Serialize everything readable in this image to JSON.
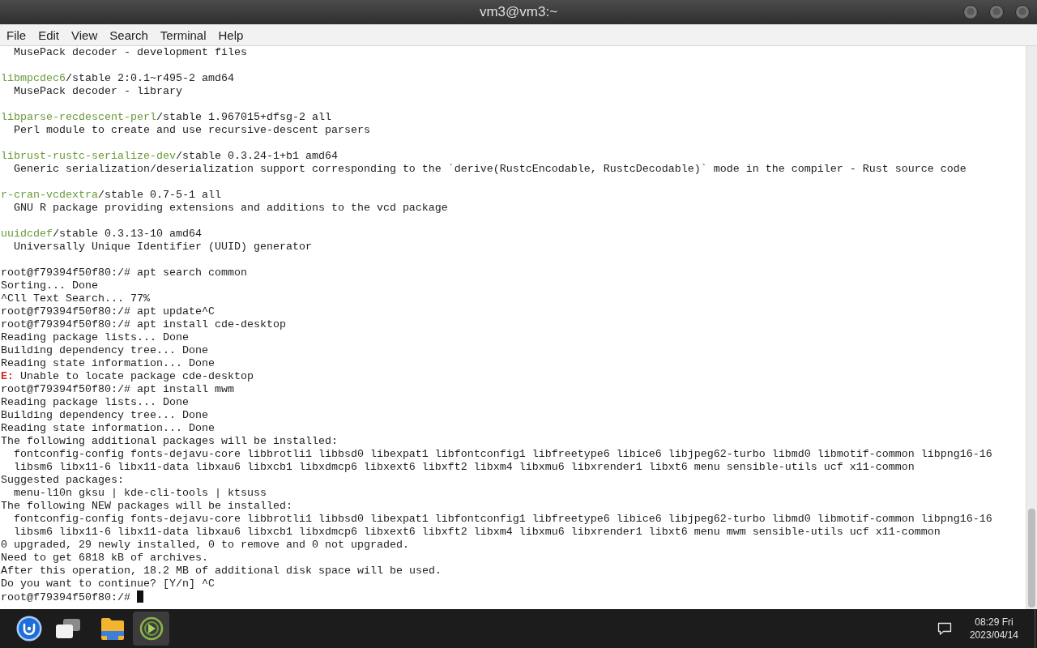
{
  "window": {
    "title": "vm3@vm3:~"
  },
  "menu": [
    "File",
    "Edit",
    "View",
    "Search",
    "Terminal",
    "Help"
  ],
  "terminal": {
    "lines": [
      {
        "kind": "detail",
        "text": "MusePack decoder - development files"
      },
      {
        "kind": "blank"
      },
      {
        "kind": "package",
        "name": "libmpcdec6",
        "text": "/stable 2:0.1~r495-2 amd64"
      },
      {
        "kind": "detail",
        "text": "MusePack decoder - library"
      },
      {
        "kind": "blank"
      },
      {
        "kind": "package",
        "name": "libparse-recdescent-perl",
        "text": "/stable 1.967015+dfsg-2 all"
      },
      {
        "kind": "detail",
        "text": "Perl module to create and use recursive-descent parsers"
      },
      {
        "kind": "blank"
      },
      {
        "kind": "package",
        "name": "librust-rustc-serialize-dev",
        "text": "/stable 0.3.24-1+b1 amd64"
      },
      {
        "kind": "detail",
        "text": "Generic serialization/deserialization support corresponding to the `derive(RustcEncodable, RustcDecodable)` mode in the compiler - Rust source code"
      },
      {
        "kind": "blank"
      },
      {
        "kind": "package",
        "name": "r-cran-vcdextra",
        "text": "/stable 0.7-5-1 all"
      },
      {
        "kind": "detail",
        "text": "GNU R package providing extensions and additions to the vcd package"
      },
      {
        "kind": "blank"
      },
      {
        "kind": "package",
        "name": "uuidcdef",
        "text": "/stable 0.3.13-10 amd64"
      },
      {
        "kind": "detail",
        "text": "Universally Unique Identifier (UUID) generator"
      },
      {
        "kind": "blank"
      },
      {
        "kind": "plain",
        "text": "root@f79394f50f80:/# apt search common"
      },
      {
        "kind": "plain",
        "text": "Sorting... Done"
      },
      {
        "kind": "plain",
        "text": "^Cll Text Search... 77%"
      },
      {
        "kind": "plain",
        "text": "root@f79394f50f80:/# apt update^C"
      },
      {
        "kind": "plain",
        "text": "root@f79394f50f80:/# apt install cde-desktop"
      },
      {
        "kind": "plain",
        "text": "Reading package lists... Done"
      },
      {
        "kind": "plain",
        "text": "Building dependency tree... Done"
      },
      {
        "kind": "plain",
        "text": "Reading state information... Done"
      },
      {
        "kind": "error",
        "tag": "E:",
        "text": "Unable to locate package cde-desktop"
      },
      {
        "kind": "plain",
        "text": "root@f79394f50f80:/# apt install mwm"
      },
      {
        "kind": "plain",
        "text": "Reading package lists... Done"
      },
      {
        "kind": "plain",
        "text": "Building dependency tree... Done"
      },
      {
        "kind": "plain",
        "text": "Reading state information... Done"
      },
      {
        "kind": "plain",
        "text": "The following additional packages will be installed:"
      },
      {
        "kind": "detail",
        "text": "fontconfig-config fonts-dejavu-core libbrotli1 libbsd0 libexpat1 libfontconfig1 libfreetype6 libice6 libjpeg62-turbo libmd0 libmotif-common libpng16-16"
      },
      {
        "kind": "detail",
        "text": "libsm6 libx11-6 libx11-data libxau6 libxcb1 libxdmcp6 libxext6 libxft2 libxm4 libxmu6 libxrender1 libxt6 menu sensible-utils ucf x11-common"
      },
      {
        "kind": "plain",
        "text": "Suggested packages:"
      },
      {
        "kind": "detail",
        "text": "menu-l10n gksu | kde-cli-tools | ktsuss"
      },
      {
        "kind": "plain",
        "text": "The following NEW packages will be installed:"
      },
      {
        "kind": "detail",
        "text": "fontconfig-config fonts-dejavu-core libbrotli1 libbsd0 libexpat1 libfontconfig1 libfreetype6 libice6 libjpeg62-turbo libmd0 libmotif-common libpng16-16"
      },
      {
        "kind": "detail",
        "text": "libsm6 libx11-6 libx11-data libxau6 libxcb1 libxdmcp6 libxext6 libxft2 libxm4 libxmu6 libxrender1 libxt6 menu mwm sensible-utils ucf x11-common"
      },
      {
        "kind": "plain",
        "text": "0 upgraded, 29 newly installed, 0 to remove and 0 not upgraded."
      },
      {
        "kind": "plain",
        "text": "Need to get 6818 kB of archives."
      },
      {
        "kind": "plain",
        "text": "After this operation, 18.2 MB of additional disk space will be used."
      },
      {
        "kind": "plain",
        "text": "Do you want to continue? [Y/n] ^C"
      },
      {
        "kind": "plain",
        "text": "root@f79394f50f80:/#",
        "cursor": true
      }
    ]
  },
  "taskbar": {
    "apps": [
      {
        "kind": "start",
        "selected": false
      },
      {
        "kind": "windows",
        "selected": false
      },
      {
        "kind": "folder",
        "selected": false
      },
      {
        "kind": "terminal",
        "selected": true
      }
    ],
    "clock": {
      "time": "08:29 Fri",
      "date": "2023/04/14"
    }
  }
}
